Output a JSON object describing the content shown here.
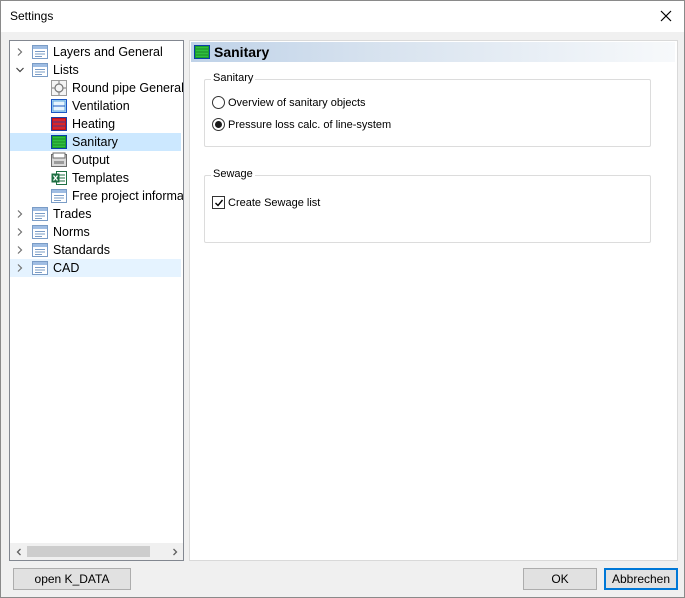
{
  "window": {
    "title": "Settings",
    "close_label": "×"
  },
  "tree": {
    "items": [
      {
        "label": "Layers and General",
        "level": 0,
        "expander": "collapsed",
        "icon": "list-icon",
        "state": ""
      },
      {
        "label": "Lists",
        "level": 0,
        "expander": "expanded",
        "icon": "list-icon",
        "state": ""
      },
      {
        "label": "Round pipe General",
        "level": 1,
        "expander": "none",
        "icon": "round-pipe-icon",
        "state": ""
      },
      {
        "label": "Ventilation",
        "level": 1,
        "expander": "none",
        "icon": "ventilation-icon",
        "state": ""
      },
      {
        "label": "Heating",
        "level": 1,
        "expander": "none",
        "icon": "heating-icon",
        "state": ""
      },
      {
        "label": "Sanitary",
        "level": 1,
        "expander": "none",
        "icon": "sanitary-icon",
        "state": "selected"
      },
      {
        "label": "Output",
        "level": 1,
        "expander": "none",
        "icon": "output-icon",
        "state": ""
      },
      {
        "label": "Templates",
        "level": 1,
        "expander": "none",
        "icon": "excel-icon",
        "state": ""
      },
      {
        "label": "Free project information",
        "level": 1,
        "expander": "none",
        "icon": "list-icon",
        "state": ""
      },
      {
        "label": "Trades",
        "level": 0,
        "expander": "collapsed",
        "icon": "list-icon",
        "state": ""
      },
      {
        "label": "Norms",
        "level": 0,
        "expander": "collapsed",
        "icon": "list-icon",
        "state": ""
      },
      {
        "label": "Standards",
        "level": 0,
        "expander": "collapsed",
        "icon": "list-icon",
        "state": ""
      },
      {
        "label": "CAD",
        "level": 0,
        "expander": "collapsed",
        "icon": "list-icon",
        "state": "hover"
      }
    ]
  },
  "content": {
    "header_title": "Sanitary",
    "sanitary_group": {
      "label": "Sanitary",
      "options": [
        {
          "label": "Overview of sanitary objects",
          "checked": false
        },
        {
          "label": "Pressure loss calc. of line-system",
          "checked": true
        }
      ]
    },
    "sewage_group": {
      "label": "Sewage",
      "checkbox_label": "Create Sewage list",
      "checked": true
    }
  },
  "footer": {
    "open_kdata_label": "open K_DATA",
    "ok_label": "OK",
    "cancel_label": "Abbrechen"
  },
  "colors": {
    "selection": "#cce8ff",
    "hover": "#e5f3ff",
    "accent": "#0078d7"
  }
}
